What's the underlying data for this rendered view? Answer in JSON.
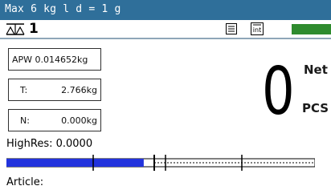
{
  "header": {
    "capacity_text": "Max 6 kg  l  d = 1 g",
    "bar_color": "#2f6f9a"
  },
  "scale": {
    "number": "1",
    "icon": "balance-scale-icon"
  },
  "toolbar": {
    "doc_icon": "document-list-icon",
    "int_icon": "int-resolution-icon",
    "indicator_color": "#2e8b2e"
  },
  "fields": {
    "apw": "APW 0.014652kg",
    "tare_label": "T:",
    "tare_value": "2.766kg",
    "net_label": "N:",
    "net_value": "0.000kg"
  },
  "display": {
    "main_value": "0",
    "net_label": "Net",
    "unit": "PCS"
  },
  "highres": "HighRes: 0.0000",
  "bar_graph": {
    "fill_fraction": 0.445,
    "fill_color": "#2233dd"
  },
  "article_label": "Article:"
}
